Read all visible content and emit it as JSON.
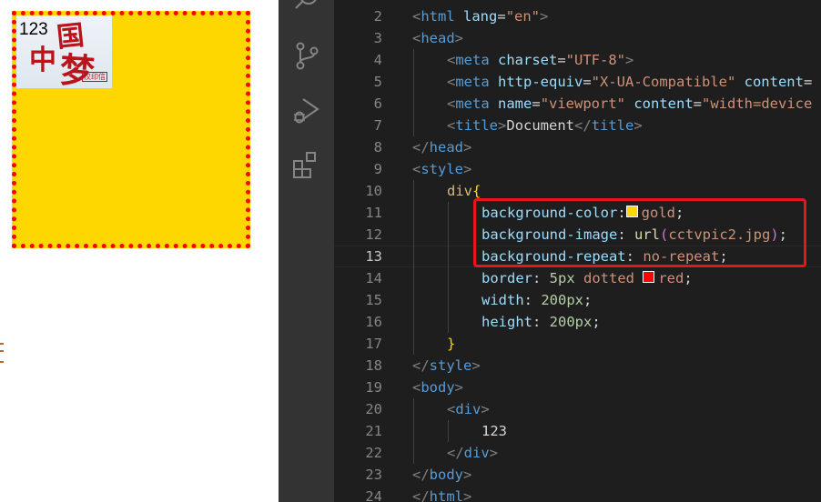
{
  "preview": {
    "box_text": "123",
    "box_background": "#ffd700",
    "box_border_color": "#ff0000",
    "image_glyphs": [
      "国",
      "中",
      "梦"
    ],
    "image_stamp": "汉印信"
  },
  "activity_bar": {
    "icons": [
      "search-icon",
      "source-control-icon",
      "run-debug-icon",
      "extensions-icon"
    ]
  },
  "editor": {
    "current_line": 13,
    "highlight_color": "#e8141e",
    "lines": [
      {
        "n": "2",
        "indent": 0,
        "tokens": [
          [
            "<",
            "br"
          ],
          [
            "html",
            "tag"
          ],
          [
            " lang",
            "attr"
          ],
          [
            "=",
            "text"
          ],
          [
            "\"en\"",
            "str"
          ],
          [
            ">",
            "br"
          ]
        ]
      },
      {
        "n": "3",
        "indent": 0,
        "tokens": [
          [
            "<",
            "br"
          ],
          [
            "head",
            "tag"
          ],
          [
            ">",
            "br"
          ]
        ]
      },
      {
        "n": "4",
        "indent": 1,
        "tokens": [
          [
            "<",
            "br"
          ],
          [
            "meta",
            "tag"
          ],
          [
            " charset",
            "attr"
          ],
          [
            "=",
            "text"
          ],
          [
            "\"UTF-8\"",
            "str"
          ],
          [
            ">",
            "br"
          ]
        ]
      },
      {
        "n": "5",
        "indent": 1,
        "tokens": [
          [
            "<",
            "br"
          ],
          [
            "meta",
            "tag"
          ],
          [
            " http-equiv",
            "attr"
          ],
          [
            "=",
            "text"
          ],
          [
            "\"X-UA-Compatible\"",
            "str"
          ],
          [
            " content",
            "attr"
          ],
          [
            "=",
            "text"
          ]
        ]
      },
      {
        "n": "6",
        "indent": 1,
        "tokens": [
          [
            "<",
            "br"
          ],
          [
            "meta",
            "tag"
          ],
          [
            " name",
            "attr"
          ],
          [
            "=",
            "text"
          ],
          [
            "\"viewport\"",
            "str"
          ],
          [
            " content",
            "attr"
          ],
          [
            "=",
            "text"
          ],
          [
            "\"width=device",
            "str"
          ]
        ]
      },
      {
        "n": "7",
        "indent": 1,
        "tokens": [
          [
            "<",
            "br"
          ],
          [
            "title",
            "tag"
          ],
          [
            ">",
            "br"
          ],
          [
            "Document",
            "text"
          ],
          [
            "</",
            "br"
          ],
          [
            "title",
            "tag"
          ],
          [
            ">",
            "br"
          ]
        ]
      },
      {
        "n": "8",
        "indent": 0,
        "tokens": [
          [
            "</",
            "br"
          ],
          [
            "head",
            "tag"
          ],
          [
            ">",
            "br"
          ]
        ]
      },
      {
        "n": "9",
        "indent": 0,
        "tokens": [
          [
            "<",
            "br"
          ],
          [
            "style",
            "tag"
          ],
          [
            ">",
            "br"
          ]
        ]
      },
      {
        "n": "10",
        "indent": 1,
        "tokens": [
          [
            "div",
            "sel"
          ],
          [
            "{",
            "curly"
          ]
        ]
      },
      {
        "n": "11",
        "indent": 2,
        "tokens": [
          [
            "background-color",
            "prop"
          ],
          [
            ":",
            "text"
          ],
          [
            "#ffd700",
            "swatch"
          ],
          [
            "gold",
            "val"
          ],
          [
            ";",
            "text"
          ]
        ]
      },
      {
        "n": "12",
        "indent": 2,
        "tokens": [
          [
            "background-image",
            "prop"
          ],
          [
            ": ",
            "text"
          ],
          [
            "url",
            "fn"
          ],
          [
            "(",
            "paren"
          ],
          [
            "cctvpic2.jpg",
            "val"
          ],
          [
            ")",
            "paren"
          ],
          [
            ";",
            "text"
          ]
        ]
      },
      {
        "n": "13",
        "indent": 2,
        "tokens": [
          [
            "background-repeat",
            "prop"
          ],
          [
            ": ",
            "text"
          ],
          [
            "no-repeat",
            "val"
          ],
          [
            ";",
            "text"
          ]
        ]
      },
      {
        "n": "14",
        "indent": 2,
        "tokens": [
          [
            "border",
            "prop"
          ],
          [
            ": ",
            "text"
          ],
          [
            "5px",
            "num"
          ],
          [
            " dotted ",
            "val"
          ],
          [
            "#ff0000",
            "swatch"
          ],
          [
            "red",
            "val"
          ],
          [
            ";",
            "text"
          ]
        ]
      },
      {
        "n": "15",
        "indent": 2,
        "tokens": [
          [
            "width",
            "prop"
          ],
          [
            ": ",
            "text"
          ],
          [
            "200px",
            "num"
          ],
          [
            ";",
            "text"
          ]
        ]
      },
      {
        "n": "16",
        "indent": 2,
        "tokens": [
          [
            "height",
            "prop"
          ],
          [
            ": ",
            "text"
          ],
          [
            "200px",
            "num"
          ],
          [
            ";",
            "text"
          ]
        ]
      },
      {
        "n": "17",
        "indent": 1,
        "tokens": [
          [
            "}",
            "curly"
          ]
        ]
      },
      {
        "n": "18",
        "indent": 0,
        "tokens": [
          [
            "</",
            "br"
          ],
          [
            "style",
            "tag"
          ],
          [
            ">",
            "br"
          ]
        ]
      },
      {
        "n": "19",
        "indent": 0,
        "tokens": [
          [
            "<",
            "br"
          ],
          [
            "body",
            "tag"
          ],
          [
            ">",
            "br"
          ]
        ]
      },
      {
        "n": "20",
        "indent": 1,
        "tokens": [
          [
            "<",
            "br"
          ],
          [
            "div",
            "tag"
          ],
          [
            ">",
            "br"
          ]
        ]
      },
      {
        "n": "21",
        "indent": 2,
        "tokens": [
          [
            "123",
            "text"
          ]
        ]
      },
      {
        "n": "22",
        "indent": 1,
        "tokens": [
          [
            "</",
            "br"
          ],
          [
            "div",
            "tag"
          ],
          [
            ">",
            "br"
          ]
        ]
      },
      {
        "n": "23",
        "indent": 0,
        "tokens": [
          [
            "</",
            "br"
          ],
          [
            "body",
            "tag"
          ],
          [
            ">",
            "br"
          ]
        ]
      },
      {
        "n": "24",
        "indent": 0,
        "tokens": [
          [
            "</",
            "br"
          ],
          [
            "html",
            "tag"
          ],
          [
            ">",
            "br"
          ]
        ]
      }
    ]
  }
}
